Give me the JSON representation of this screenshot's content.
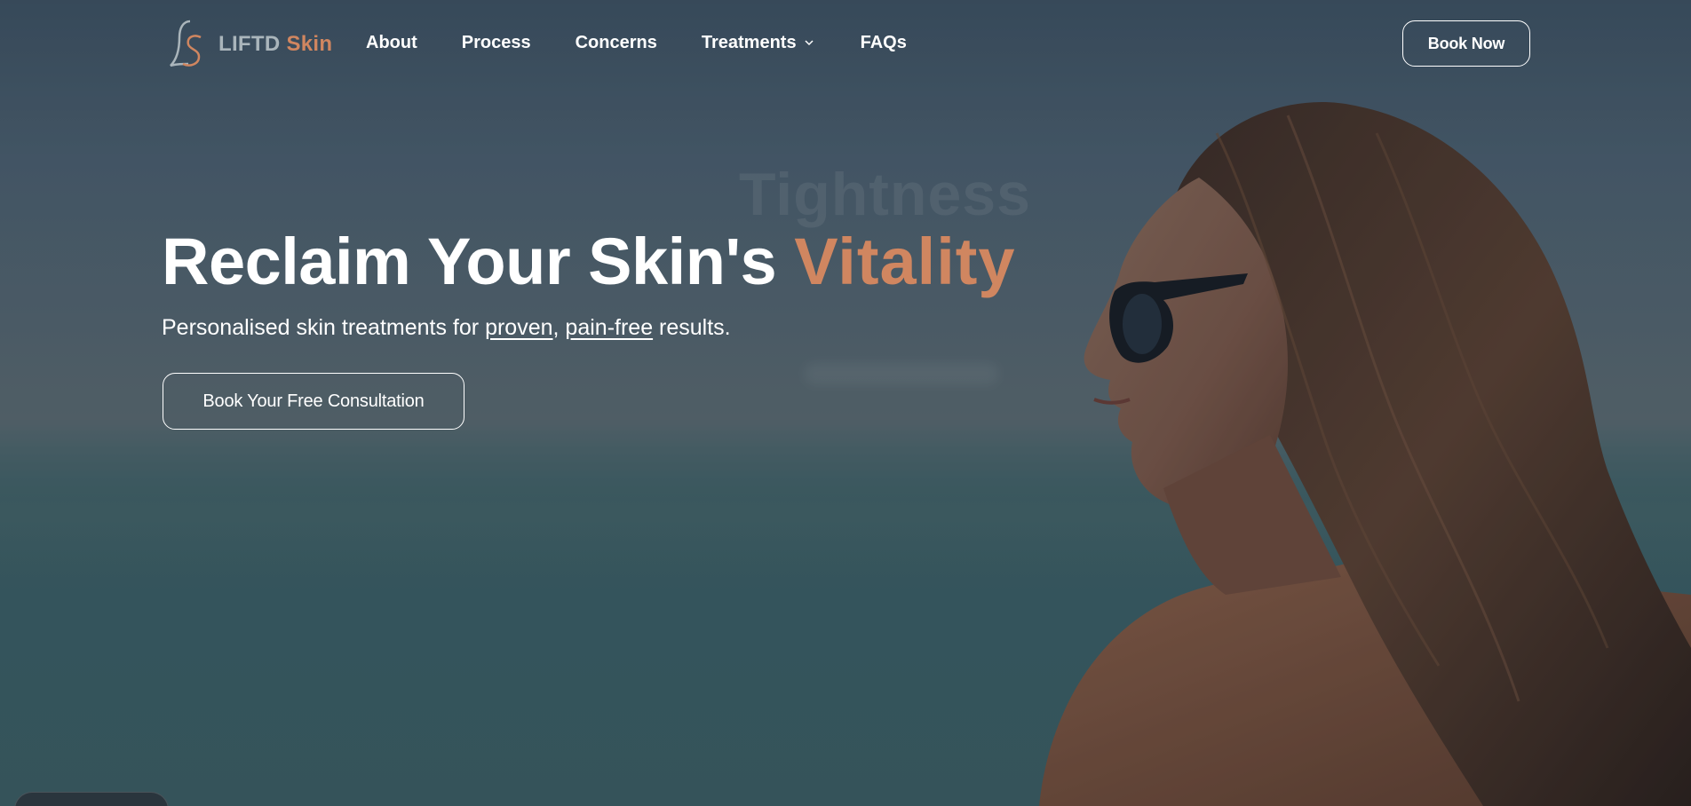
{
  "brand": {
    "word1": "LIFTD",
    "word2": "Skin",
    "logo_monogram": "LS",
    "colors": {
      "accent": "#d08660",
      "muted": "#aab5bb"
    }
  },
  "nav": {
    "items": [
      {
        "label": "About"
      },
      {
        "label": "Process"
      },
      {
        "label": "Concerns"
      },
      {
        "label": "Treatments",
        "has_dropdown": true
      },
      {
        "label": "FAQs"
      }
    ],
    "book_now": "Book Now"
  },
  "hero": {
    "ghost_word": "Tightness",
    "headline_main": "Reclaim Your Skin's",
    "headline_accent": "Vitality",
    "sub_before": "Personalised skin treatments for ",
    "sub_link1": "proven",
    "sub_comma": ", ",
    "sub_link2": "pain-free",
    "sub_after": " results.",
    "cta": "Book Your Free Consultation"
  },
  "icons": {
    "chevron": "chevron-down-icon",
    "logo": "ls-monogram-icon"
  }
}
